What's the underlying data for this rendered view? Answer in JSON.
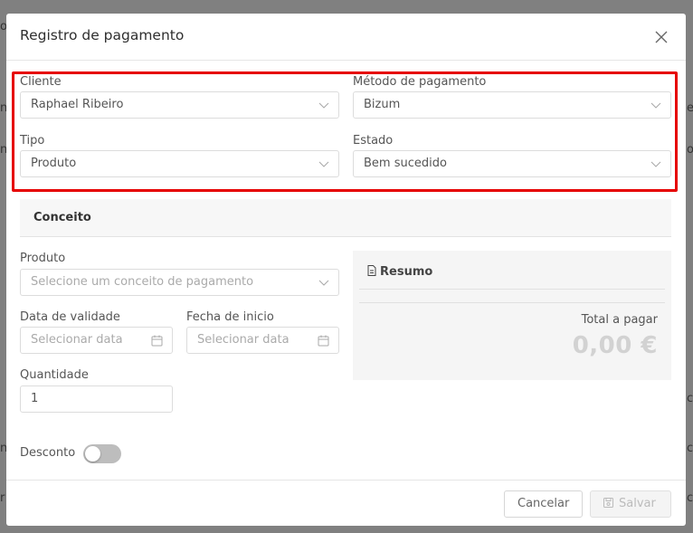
{
  "background": {
    "left_fragments": [
      "o",
      "n",
      "n",
      "n",
      "r"
    ],
    "right_fragments": [
      "e",
      "o",
      "c",
      "c",
      "c"
    ]
  },
  "modal": {
    "title": "Registro de pagamento"
  },
  "form": {
    "cliente": {
      "label": "Cliente",
      "value": "Raphael Ribeiro"
    },
    "metodo": {
      "label": "Método de pagamento",
      "value": "Bizum"
    },
    "tipo": {
      "label": "Tipo",
      "value": "Produto"
    },
    "estado": {
      "label": "Estado",
      "value": "Bem sucedido"
    }
  },
  "concept": {
    "section_title": "Conceito",
    "produto": {
      "label": "Produto",
      "placeholder": "Selecione um conceito de pagamento"
    },
    "data_validade": {
      "label": "Data de validade",
      "placeholder": "Selecionar data"
    },
    "fecha_inicio": {
      "label": "Fecha de inicio",
      "placeholder": "Selecionar data"
    },
    "quantidade": {
      "label": "Quantidade",
      "value": "1"
    },
    "desconto": {
      "label": "Desconto",
      "enabled": false
    }
  },
  "summary": {
    "title": "Resumo",
    "total_label": "Total a pagar",
    "total_value": "0,00 €"
  },
  "footer": {
    "cancel_label": "Cancelar",
    "save_label": "Salvar"
  },
  "colors": {
    "highlight_border": "#e60000",
    "toggle_off": "#bdbdbd",
    "total_value": "#d2d2d2"
  },
  "icons": {
    "close": "close-icon",
    "chevron": "chevron-down-icon",
    "calendar": "calendar-icon",
    "document": "document-icon",
    "save": "save-icon"
  }
}
